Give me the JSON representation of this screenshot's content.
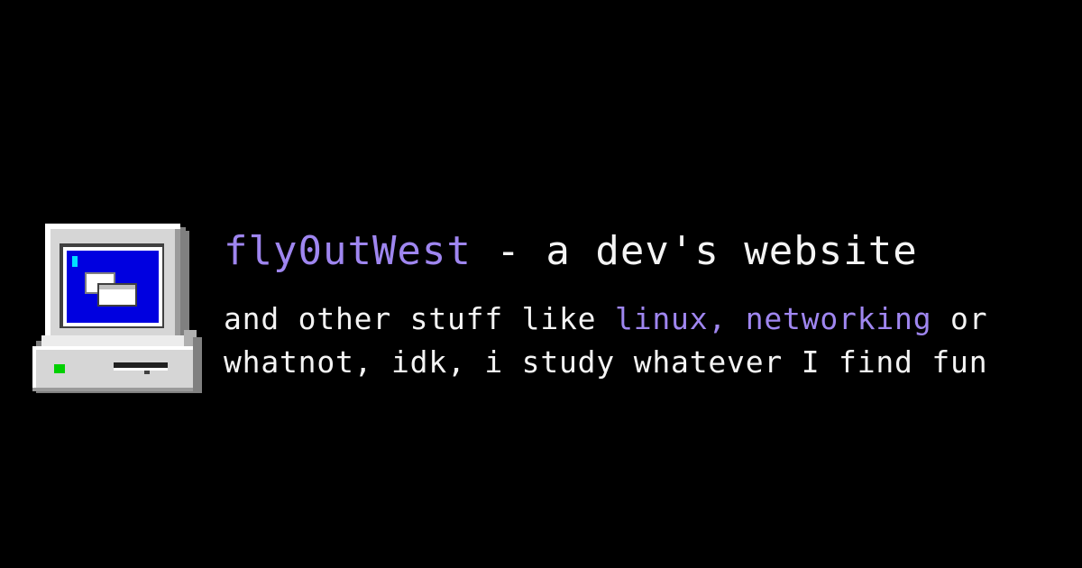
{
  "colors": {
    "background": "#000000",
    "text": "#f4f4f4",
    "accent": "#9f86f0",
    "screen": "#0000e0",
    "case_light": "#d6d6d6",
    "case_dark": "#808080",
    "power_led": "#00d000"
  },
  "icon": {
    "name": "retro-computer-icon"
  },
  "headline": {
    "site_name": "fly0utWest",
    "rest": " - a dev's website"
  },
  "tagline": {
    "line1_start": "and other stuff like ",
    "line1_topics": "linux, networking",
    "line1_end": " or",
    "line2": "whatnot, idk, i study whatever I find fun"
  }
}
